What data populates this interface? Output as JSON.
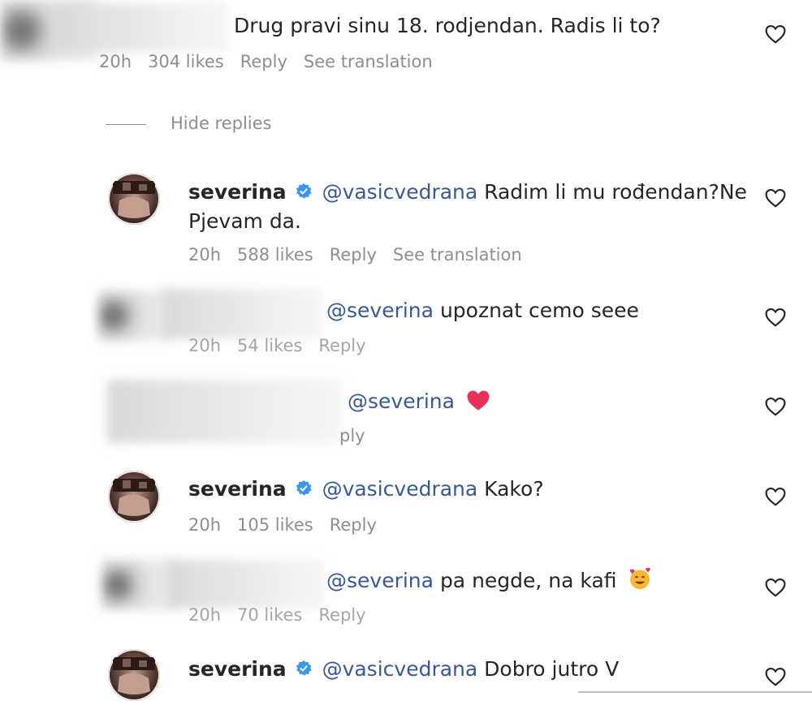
{
  "comments": [
    {
      "text": "Drug pravi sinu 18. rodjendan. Radis li to?",
      "time": "20h",
      "likes": "304 likes",
      "reply": "Reply",
      "translate": "See translation"
    }
  ],
  "hide_replies": "Hide replies",
  "replies": [
    {
      "username": "severina",
      "mention": "@vasicvedrana",
      "text_line1": "Radim li mu rođendan?Ne",
      "text_line2": "Pjevam da.",
      "time": "20h",
      "likes": "588 likes",
      "reply": "Reply",
      "translate": "See translation"
    },
    {
      "mention": "@severina",
      "text": "upoznat cemo seee",
      "time": "20h",
      "likes": "54 likes",
      "reply": "Reply"
    },
    {
      "mention": "@severina",
      "text": "",
      "reply": "ply"
    },
    {
      "username": "severina",
      "mention": "@vasicvedrana",
      "text": "Kako?",
      "time": "20h",
      "likes": "105 likes",
      "reply": "Reply"
    },
    {
      "mention": "@severina",
      "text": "pa negde, na kafi",
      "time": "20h",
      "likes": "70 likes",
      "reply": "Reply"
    },
    {
      "username": "severina",
      "mention": "@vasicvedrana",
      "text": "Dobro jutro V"
    }
  ],
  "icons": {
    "like": "heart-outline-icon",
    "verified": "verified-badge-icon",
    "heart_emoji": "red-heart-emoji",
    "laugh_emoji": "smiling-hearts-emoji"
  },
  "colors": {
    "text": "#262626",
    "meta": "#8e8e8e",
    "mention": "#385898",
    "verified": "#3897f0",
    "heart_emoji": "#e8305a"
  }
}
